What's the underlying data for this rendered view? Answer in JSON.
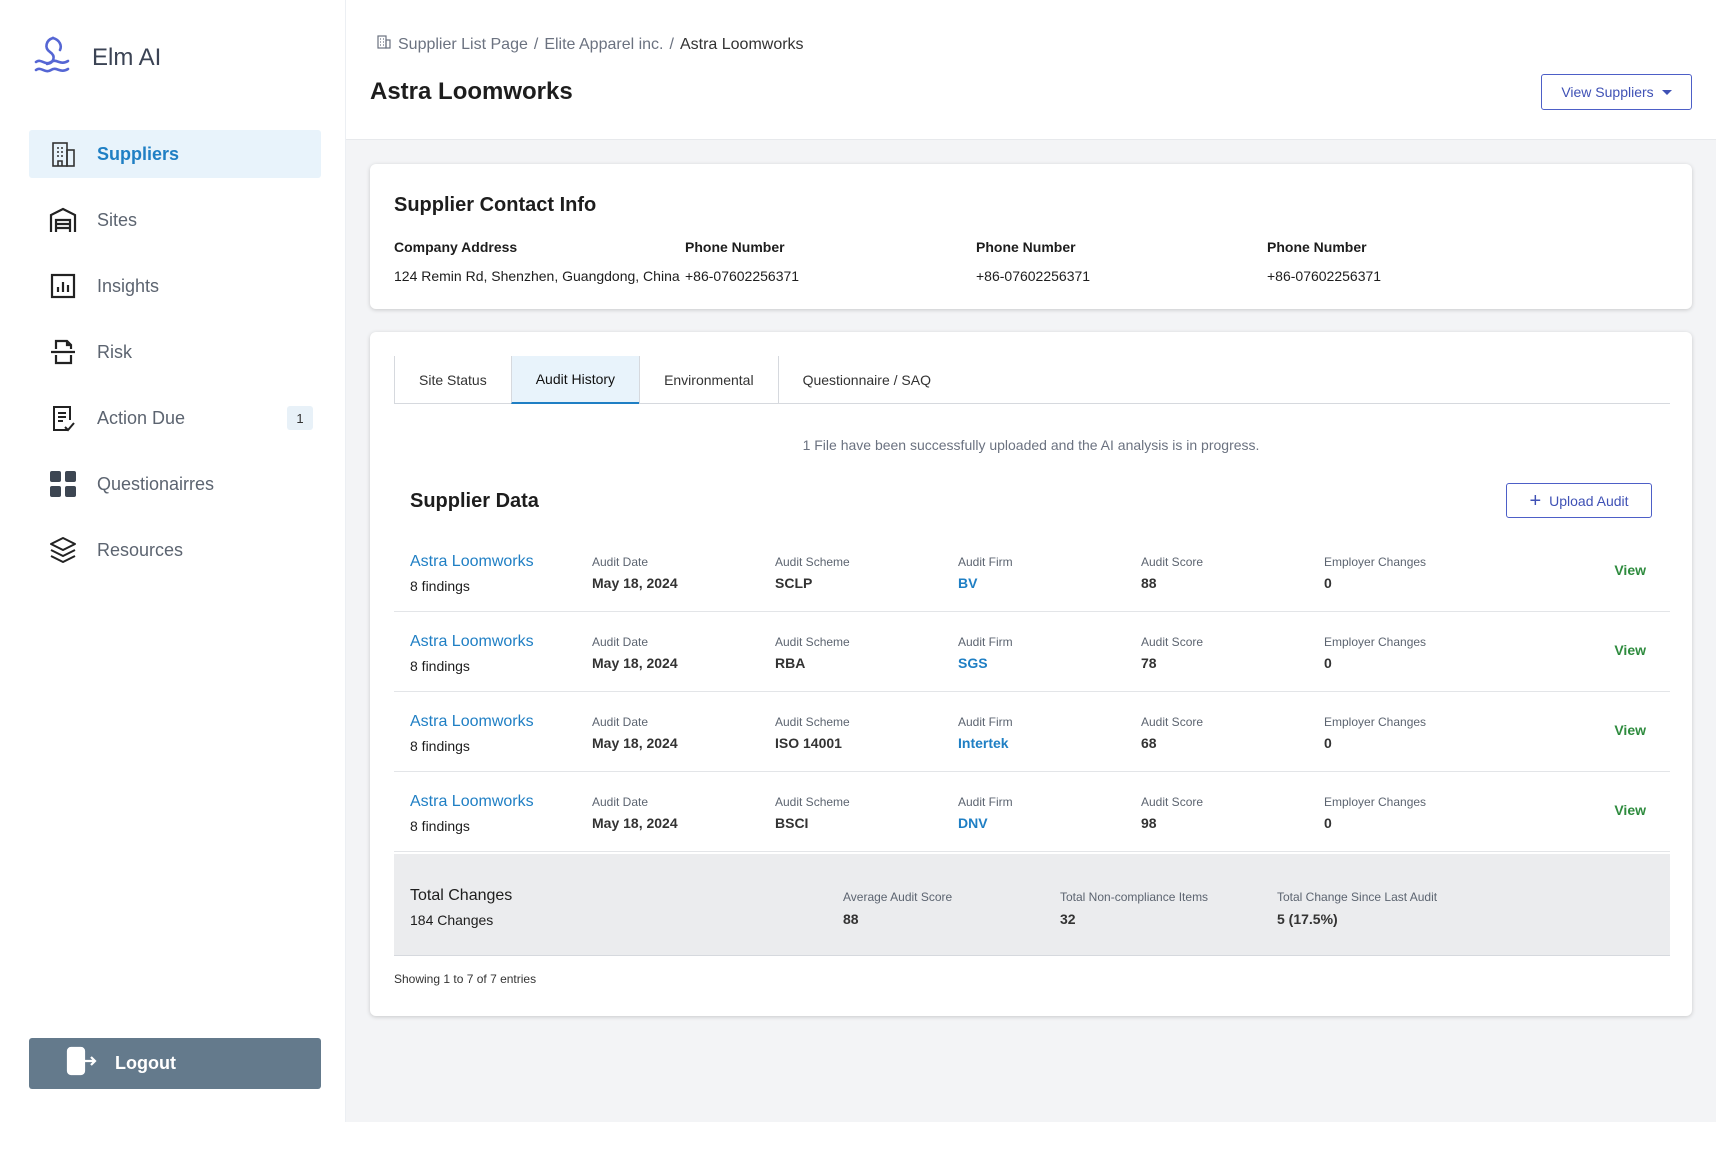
{
  "brand": {
    "name": "Elm AI",
    "logo_icon": "wave-logo-icon",
    "accent": "#4d5fc7"
  },
  "sidebar": {
    "items": [
      {
        "label": "Suppliers",
        "icon": "building-icon",
        "active": true
      },
      {
        "label": "Sites",
        "icon": "warehouse-icon",
        "active": false
      },
      {
        "label": "Insights",
        "icon": "bar-chart-icon",
        "active": false
      },
      {
        "label": "Risk",
        "icon": "risk-icon",
        "active": false
      },
      {
        "label": "Action Due",
        "icon": "checklist-icon",
        "active": false,
        "badge": "1"
      },
      {
        "label": "Questionairres",
        "icon": "grid-icon",
        "active": false
      },
      {
        "label": "Resources",
        "icon": "layers-icon",
        "active": false
      }
    ],
    "logout_label": "Logout"
  },
  "header": {
    "breadcrumb": [
      "Supplier List Page",
      "Elite Apparel inc.",
      "Astra Loomworks"
    ],
    "separator": "/",
    "title": "Astra Loomworks",
    "view_suppliers_label": "View Suppliers"
  },
  "contact": {
    "title": "Supplier Contact Info",
    "columns": [
      {
        "label": "Company Address",
        "value": "124 Remin Rd, Shenzhen, Guangdong, China"
      },
      {
        "label": "Phone Number",
        "value": "+86-07602256371"
      },
      {
        "label": "Phone Number",
        "value": "+86-07602256371"
      },
      {
        "label": "Phone Number",
        "value": "+86-07602256371"
      }
    ]
  },
  "tabs": [
    {
      "label": "Site Status",
      "active": false
    },
    {
      "label": "Audit History",
      "active": true
    },
    {
      "label": "Environmental",
      "active": false
    },
    {
      "label": "Questionnaire / SAQ",
      "active": false
    }
  ],
  "notice": "1 File have been successfully uploaded and the AI analysis is in progress.",
  "supplier_data": {
    "title": "Supplier Data",
    "upload_label": "Upload Audit",
    "headers": {
      "date": "Audit Date",
      "scheme": "Audit Scheme",
      "firm": "Audit Firm",
      "score": "Audit Score",
      "changes": "Employer Changes"
    },
    "view_label": "View",
    "rows": [
      {
        "name": "Astra Loomworks",
        "findings": "8 findings",
        "date": "May 18, 2024",
        "scheme": "SCLP",
        "firm": "BV",
        "score": "88",
        "changes": "0"
      },
      {
        "name": "Astra Loomworks",
        "findings": "8 findings",
        "date": "May 18, 2024",
        "scheme": "RBA",
        "firm": "SGS",
        "score": "78",
        "changes": "0"
      },
      {
        "name": "Astra Loomworks",
        "findings": "8 findings",
        "date": "May 18, 2024",
        "scheme": "ISO 14001",
        "firm": "Intertek",
        "score": "68",
        "changes": "0"
      },
      {
        "name": "Astra Loomworks",
        "findings": "8 findings",
        "date": "May 18, 2024",
        "scheme": "BSCI",
        "firm": "DNV",
        "score": "98",
        "changes": "0"
      }
    ]
  },
  "totals": {
    "label": "Total Changes",
    "value": "184 Changes",
    "stats": [
      {
        "label": "Average Audit Score",
        "value": "88"
      },
      {
        "label": "Total Non-compliance Items",
        "value": "32"
      },
      {
        "label": "Total Change Since Last Audit",
        "value": "5 (17.5%)"
      }
    ]
  },
  "footer": {
    "showing": "Showing 1 to 7 of 7 entries"
  }
}
